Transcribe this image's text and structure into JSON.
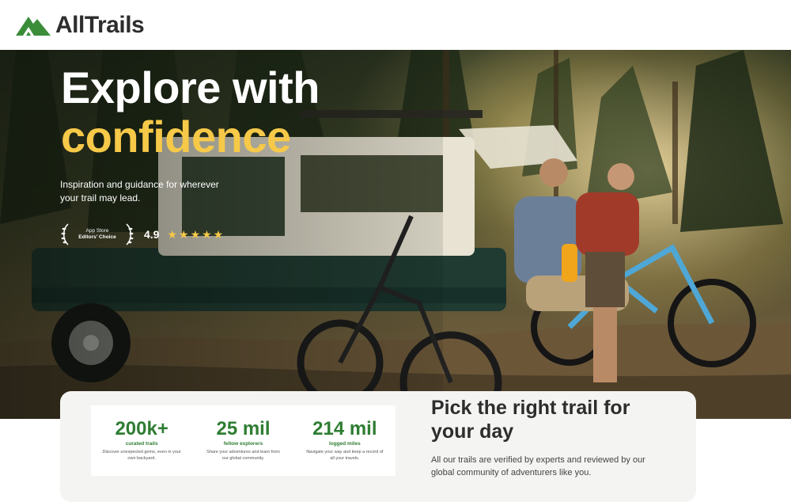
{
  "header": {
    "logo_text": "AllTrails",
    "logo_icon": "mountain-logo-icon"
  },
  "hero": {
    "headline_line1": "Explore with",
    "headline_line2": "confidence",
    "subtext": "Inspiration and guidance for wherever your trail may lead.",
    "award": {
      "apple_glyph": "",
      "line1": "App Store",
      "line2": "Editors' Choice"
    },
    "rating": "4.9",
    "stars": "★★★★★"
  },
  "stats": [
    {
      "value": "200k+",
      "label": "curated trails",
      "desc": "Discover unexpected gems, even in your own backyard."
    },
    {
      "value": "25 mil",
      "label": "fellow explorers",
      "desc": "Share your adventures and learn from our global community."
    },
    {
      "value": "214 mil",
      "label": "logged miles",
      "desc": "Navigate your way and keep a record of all your travels."
    }
  ],
  "pick": {
    "title": "Pick the right trail for your day",
    "desc": "All our trails are verified by experts and reviewed by our global community of adventurers like you."
  },
  "colors": {
    "brand_green": "#2e7d32",
    "accent_yellow": "#f7c948"
  }
}
